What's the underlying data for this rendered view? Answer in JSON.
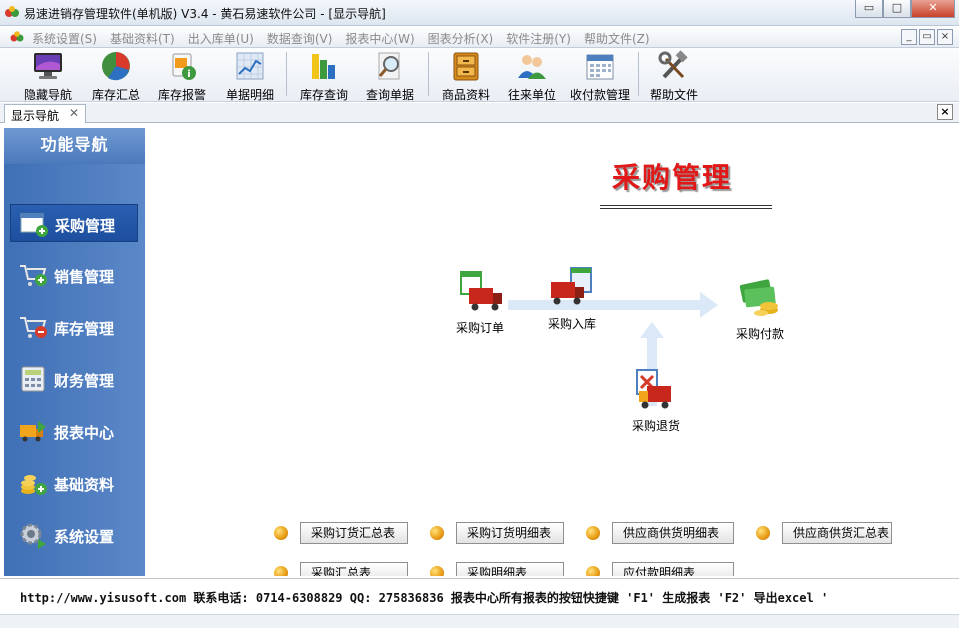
{
  "window": {
    "title": "易速进销存管理软件(单机版) V3.4 - 黄石易速软件公司 - [显示导航]",
    "minimize": "▭",
    "maximize": "□",
    "close": "✕"
  },
  "menu": {
    "items": [
      "系统设置(S)",
      "基础资料(T)",
      "出入库单(U)",
      "数据查询(V)",
      "报表中心(W)",
      "图表分析(X)",
      "软件注册(Y)",
      "帮助文件(Z)"
    ],
    "mdi": [
      "_",
      "▭",
      "×"
    ]
  },
  "toolbar": {
    "items": [
      {
        "label": "隐藏导航",
        "icon": "monitor-icon"
      },
      {
        "label": "库存汇总",
        "icon": "pie-chart-icon"
      },
      {
        "label": "库存报警",
        "icon": "rss-alert-icon"
      },
      {
        "label": "单据明细",
        "icon": "line-chart-icon"
      },
      {
        "label": "库存查询",
        "icon": "bar-chart-icon"
      },
      {
        "label": "查询单据",
        "icon": "magnifier-icon"
      },
      {
        "label": "商品资料",
        "icon": "cabinet-icon"
      },
      {
        "label": "往来单位",
        "icon": "users-icon"
      },
      {
        "label": "收付款管理",
        "icon": "calendar-icon"
      },
      {
        "label": "帮助文件",
        "icon": "tools-icon"
      }
    ]
  },
  "tab": {
    "label": "显示导航",
    "close": "✕",
    "strip_close": "×"
  },
  "nav": {
    "header": "功能导航",
    "items": [
      {
        "label": "采购管理",
        "icon": "purchase-icon",
        "active": true
      },
      {
        "label": "销售管理",
        "icon": "cart-add-icon"
      },
      {
        "label": "库存管理",
        "icon": "cart-remove-icon"
      },
      {
        "label": "财务管理",
        "icon": "calculator-icon"
      },
      {
        "label": "报表中心",
        "icon": "report-truck-icon"
      },
      {
        "label": "基础资料",
        "icon": "coins-icon"
      },
      {
        "label": "系统设置",
        "icon": "gear-icon"
      }
    ]
  },
  "main": {
    "title": "采购管理",
    "flow": {
      "order": "采购订单",
      "inbound": "采购入库",
      "payment": "采购付款",
      "return": "采购退货"
    },
    "reports_row1": [
      "采购订货汇总表",
      "采购订货明细表",
      "供应商供货明细表",
      "供应商供货汇总表"
    ],
    "reports_row2": [
      "采购汇总表",
      "采购明细表",
      "应付款明细表"
    ]
  },
  "status": {
    "text": "http://www.yisusoft.com  联系电话: 0714-6308829  QQ: 275836836 报表中心所有报表的按钮快捷键 'F1' 生成报表  'F2' 导出excel '"
  },
  "colors": {
    "nav_bg": "#4a78bb",
    "title_red": "#e01818",
    "accent_blue": "#1e4f9f"
  }
}
